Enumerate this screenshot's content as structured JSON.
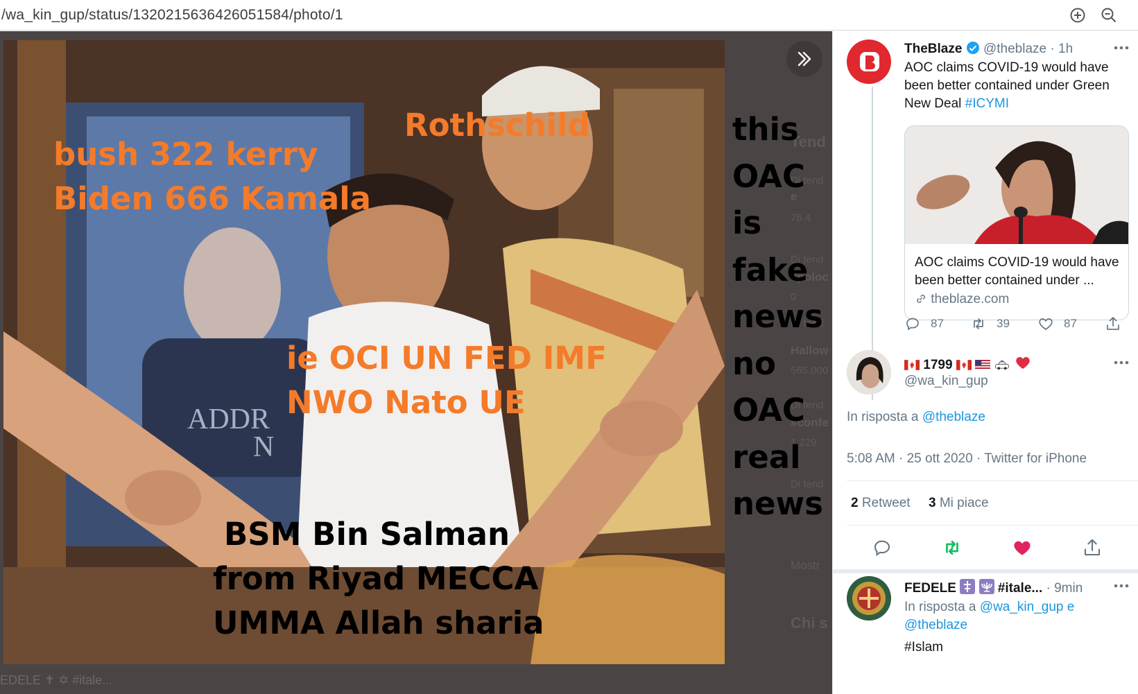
{
  "browser": {
    "url": "/wa_kin_gup/status/1320215636426051584/photo/1",
    "icons": [
      "plus-circle-icon",
      "zoom-out-icon"
    ]
  },
  "image": {
    "captions_orange": [
      "bush 322 kerry",
      "Biden 666 Kamala",
      "Rothschild",
      "ie OCI UN FED IMF",
      "NWO Nato UE"
    ],
    "captions_black": [
      "BSM Bin Salman",
      "from Riyad MECCA",
      "UMMA Allah sharia"
    ],
    "side_words": [
      "this",
      "OAC",
      "is",
      "fake",
      "news",
      "no",
      "OAC",
      "real",
      "news"
    ],
    "sign_text": [
      "ADDR",
      "N"
    ],
    "caption_color": "#f47b2a"
  },
  "background_ghost": [
    "Tend",
    "Di tend",
    "e",
    "76.4",
    "Di tend",
    "#poloc",
    "0",
    "Di tend",
    "Hallow",
    "565.000",
    "Di tend",
    "#confe",
    "1.229",
    "Di tend",
    "Mostr",
    "Chi s"
  ],
  "bottom_ghost": "EDELE ✝ ✡ #itale...",
  "tweet1": {
    "name": "TheBlaze",
    "handle": "@theblaze",
    "time": "· 1h",
    "text": "AOC claims COVID-19 would have been better contained under Green New Deal",
    "hashtag": "#ICYMI",
    "card_title": "AOC claims COVID-19 would have been better contained under ...",
    "card_domain": "theblaze.com",
    "replies": "87",
    "retweets": "39",
    "likes": "87"
  },
  "tweet2": {
    "name": "1799",
    "handle": "@wa_kin_gup",
    "reply_prefix": "In risposta a",
    "reply_to": "@theblaze",
    "timestamp": "5:08 AM · 25 ott 2020 · Twitter for iPhone",
    "retweets_count": "2",
    "retweets_label": "Retweet",
    "likes_count": "3",
    "likes_label": "Mi piace"
  },
  "tweet3": {
    "name": "FEDELE",
    "hashtag_name": "#itale...",
    "time": "· 9min",
    "reply_prefix": "In risposta a",
    "reply_to_1": "@wa_kin_gup",
    "reply_and": "e",
    "reply_to_2": "@theblaze",
    "hashtag": "#Islam"
  },
  "colors": {
    "link": "#1b95e0",
    "retweet_green": "#17bf63",
    "like_red": "#e0245e",
    "blaze_red": "#e0282e"
  }
}
